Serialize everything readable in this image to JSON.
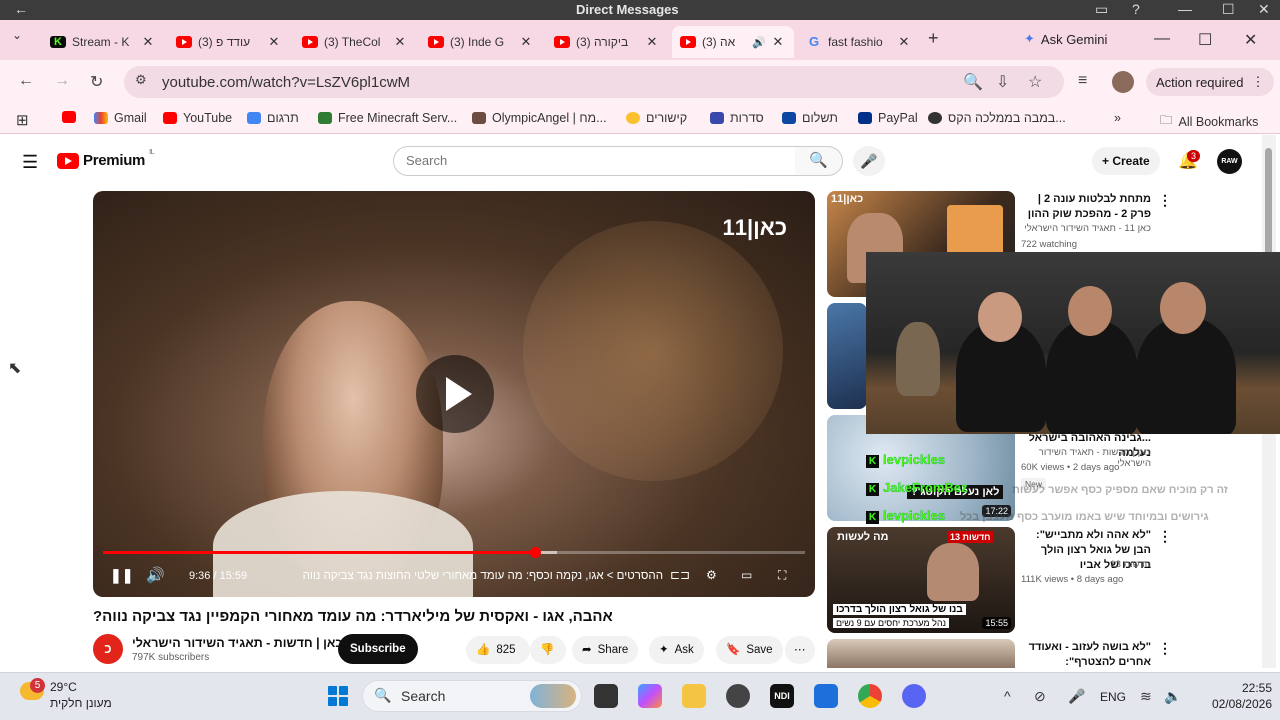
{
  "window": {
    "title": "Direct Messages"
  },
  "tabs": [
    {
      "label": "Stream - K",
      "favicon": "kick-icon"
    },
    {
      "label": "(3) עודד פ",
      "favicon": "youtube-icon"
    },
    {
      "label": "(3) TheCol",
      "favicon": "youtube-icon"
    },
    {
      "label": "(3) Inde G",
      "favicon": "youtube-icon"
    },
    {
      "label": "(3) ביקורה",
      "favicon": "youtube-icon"
    },
    {
      "label": "(3) אה",
      "favicon": "youtube-icon",
      "active": true,
      "audio": true
    },
    {
      "label": "fast fashio",
      "favicon": "google-icon"
    }
  ],
  "gemini": {
    "label": "Ask Gemini"
  },
  "address": {
    "url": "youtube.com/watch?v=LsZV6pl1cwM",
    "action_label": "Action required"
  },
  "bookmarks": {
    "items": [
      "Gmail",
      "YouTube",
      "תרגום",
      "Free Minecraft Serv...",
      "OlympicAngel | מח...",
      "קישורים",
      "סדרות",
      "תשלום",
      "PayPal",
      "במבה בממלכה הקס..."
    ],
    "all_label": "All Bookmarks"
  },
  "youtube": {
    "logo_text": "Premium",
    "logo_region": "IL",
    "search_placeholder": "Search",
    "create_label": "Create",
    "notif_count": "3",
    "avatar_text": "RAW"
  },
  "player": {
    "channel_logo": "כאן|11",
    "time": "9:36 / 15:59",
    "chapter": "ההסרטים > אגו, נקמה וכסף: מה עומד מאחורי שלטי החוצות נגד צביקה נווה",
    "progress": 0.615,
    "buffered": 0.647
  },
  "video": {
    "title": "אהבה, אגו - ואקסית של מיליארדר: מה עומד מאחורי הקמפיין נגד צביקה נווה?",
    "channel": "כאן | חדשות - תאגיד השידור הישראלי",
    "subscribers": "797K subscribers",
    "subscribe_label": "Subscribe",
    "likes": "825",
    "share_label": "Share",
    "ask_label": "Ask",
    "save_label": "Save"
  },
  "recommendations": [
    {
      "title": "מתחת לבלטות עונה 2 | פרק 2 - מהפכת שוק ההון",
      "channel": "כאן 11 - תאגיד השידור הישראלי",
      "meta": "722 watching",
      "thumb_logo": "כאן|11"
    },
    {
      "title": "",
      "channel": "",
      "meta": ""
    },
    {
      "title": "...גבינה האהובה בישראל נעלמה",
      "channel": "כאן | חדשות - תאגיד השידור הישראלי",
      "meta": "60K views • 2 days ago",
      "badge": "New",
      "duration": "17:22",
      "thumb_text": "לאן נעלם הקוטג'?"
    },
    {
      "title": "\"לא אהה ולא מתבייש\": הבן של גואל רצון הולך בדרכו של אביו",
      "channel": "חדשות 13",
      "meta": "111K views • 8 days ago",
      "duration": "15:55",
      "thumb_text": "בנו של גואל רצון הולך בדרכו",
      "thumb_sub": "נהל מערכת יחסים עם 9 נשים",
      "thumb_tag": "מה לעשות"
    },
    {
      "title": "\"לא בושה לעזוב - ואעודד אחרים להצטרף\": הפטריוטים שנפרדו",
      "channel": "",
      "meta": ""
    }
  ],
  "kick_overlay": {
    "lines": [
      "levpickles",
      "JakeFromBez",
      "levpickles"
    ]
  },
  "ghost_chat": [
    "זה רק מוכיח שאם מספיק כסף אפשר לעשות",
    "גירושים ובמיוחד שיש באמו מוערב כסף מעצבן בכל"
  ],
  "taskbar": {
    "temp": "29°C",
    "weather": "מעונן חלקית",
    "weather_badge": "5",
    "search_label": "Search",
    "lang": "ENG",
    "time": "22:55",
    "date": "02/08/2026"
  }
}
